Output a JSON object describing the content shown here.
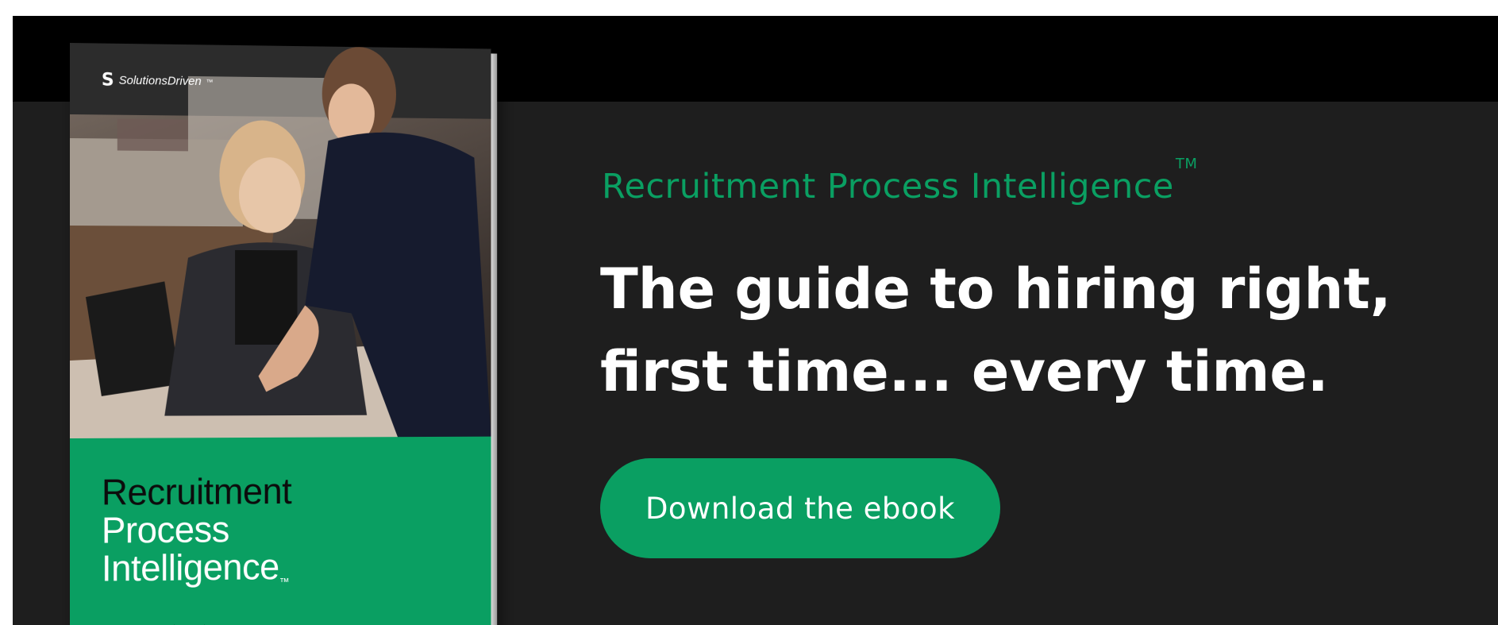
{
  "book": {
    "logo_text": "SolutionsDriven",
    "logo_mark": "S",
    "logo_tm": "™",
    "title_line1": "Recruitment",
    "title_line2": "Process",
    "title_line3": "Intelligence",
    "title_tm": "™"
  },
  "hero": {
    "eyebrow": "Recruitment Process Intelligence",
    "eyebrow_tm": "TM",
    "headline_line1": "The guide to hiring right,",
    "headline_line2": "first time... every time."
  },
  "cta": {
    "label": "Download the ebook"
  },
  "colors": {
    "brand_green": "#0a9f62",
    "background": "#1e1e1e",
    "top_strip": "#000000"
  }
}
